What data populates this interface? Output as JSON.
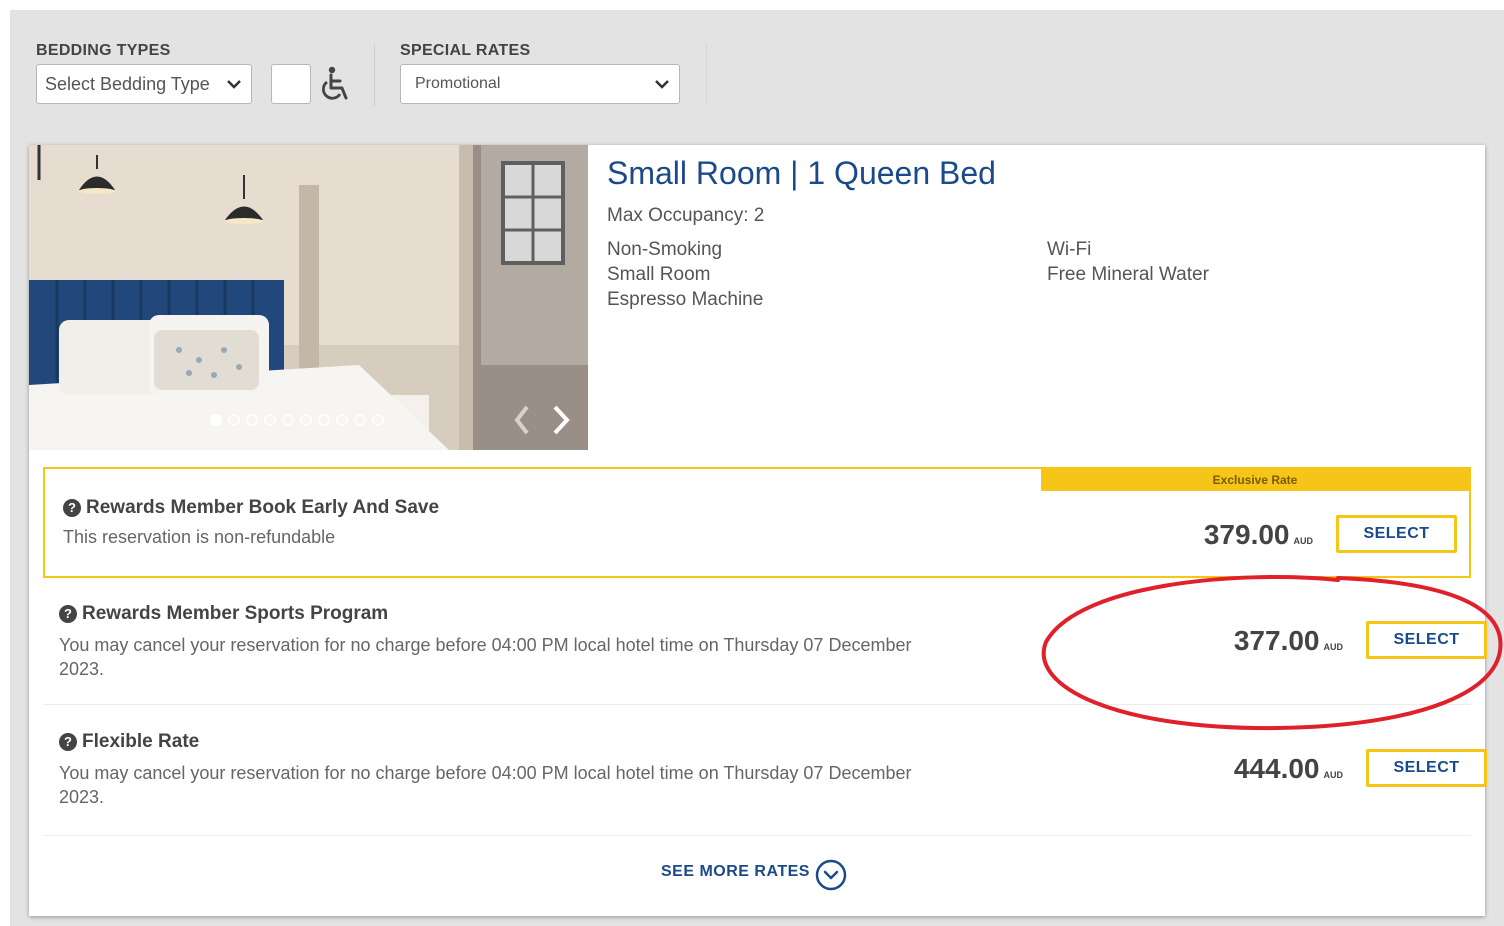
{
  "filters": {
    "bedding_label": "BEDDING TYPES",
    "bedding_value": "Select Bedding Type",
    "special_rates_label": "SPECIAL RATES",
    "special_rates_value": "Promotional",
    "accessible_icon": "wheelchair-icon"
  },
  "room": {
    "title": "Small Room | 1 Queen Bed",
    "max_occupancy": "Max Occupancy: 2",
    "amenities_left": [
      "Non-Smoking",
      "Small Room",
      "Espresso Machine"
    ],
    "amenities_right": [
      "Wi-Fi",
      "Free Mineral Water"
    ],
    "gallery": {
      "total_images": 10,
      "current_index": 1
    }
  },
  "rates": [
    {
      "badge": "Exclusive Rate",
      "name": "Rewards Member Book Early And Save",
      "description": "This reservation is non-refundable",
      "price": "379.00",
      "currency": "AUD",
      "button": "SELECT"
    },
    {
      "name": "Rewards Member Sports Program",
      "description": "You may cancel your reservation for no charge before 04:00 PM local hotel time on Thursday 07 December 2023.",
      "price": "377.00",
      "currency": "AUD",
      "button": "SELECT",
      "highlighted": true
    },
    {
      "name": "Flexible Rate",
      "description": "You may cancel your reservation for no charge before 04:00 PM local hotel time on Thursday 07 December 2023.",
      "price": "444.00",
      "currency": "AUD",
      "button": "SELECT"
    }
  ],
  "see_more": "SEE MORE RATES",
  "colors": {
    "brand_blue": "#1a4a8a",
    "accent_yellow": "#f5c518",
    "highlight_red": "#e0202a"
  }
}
